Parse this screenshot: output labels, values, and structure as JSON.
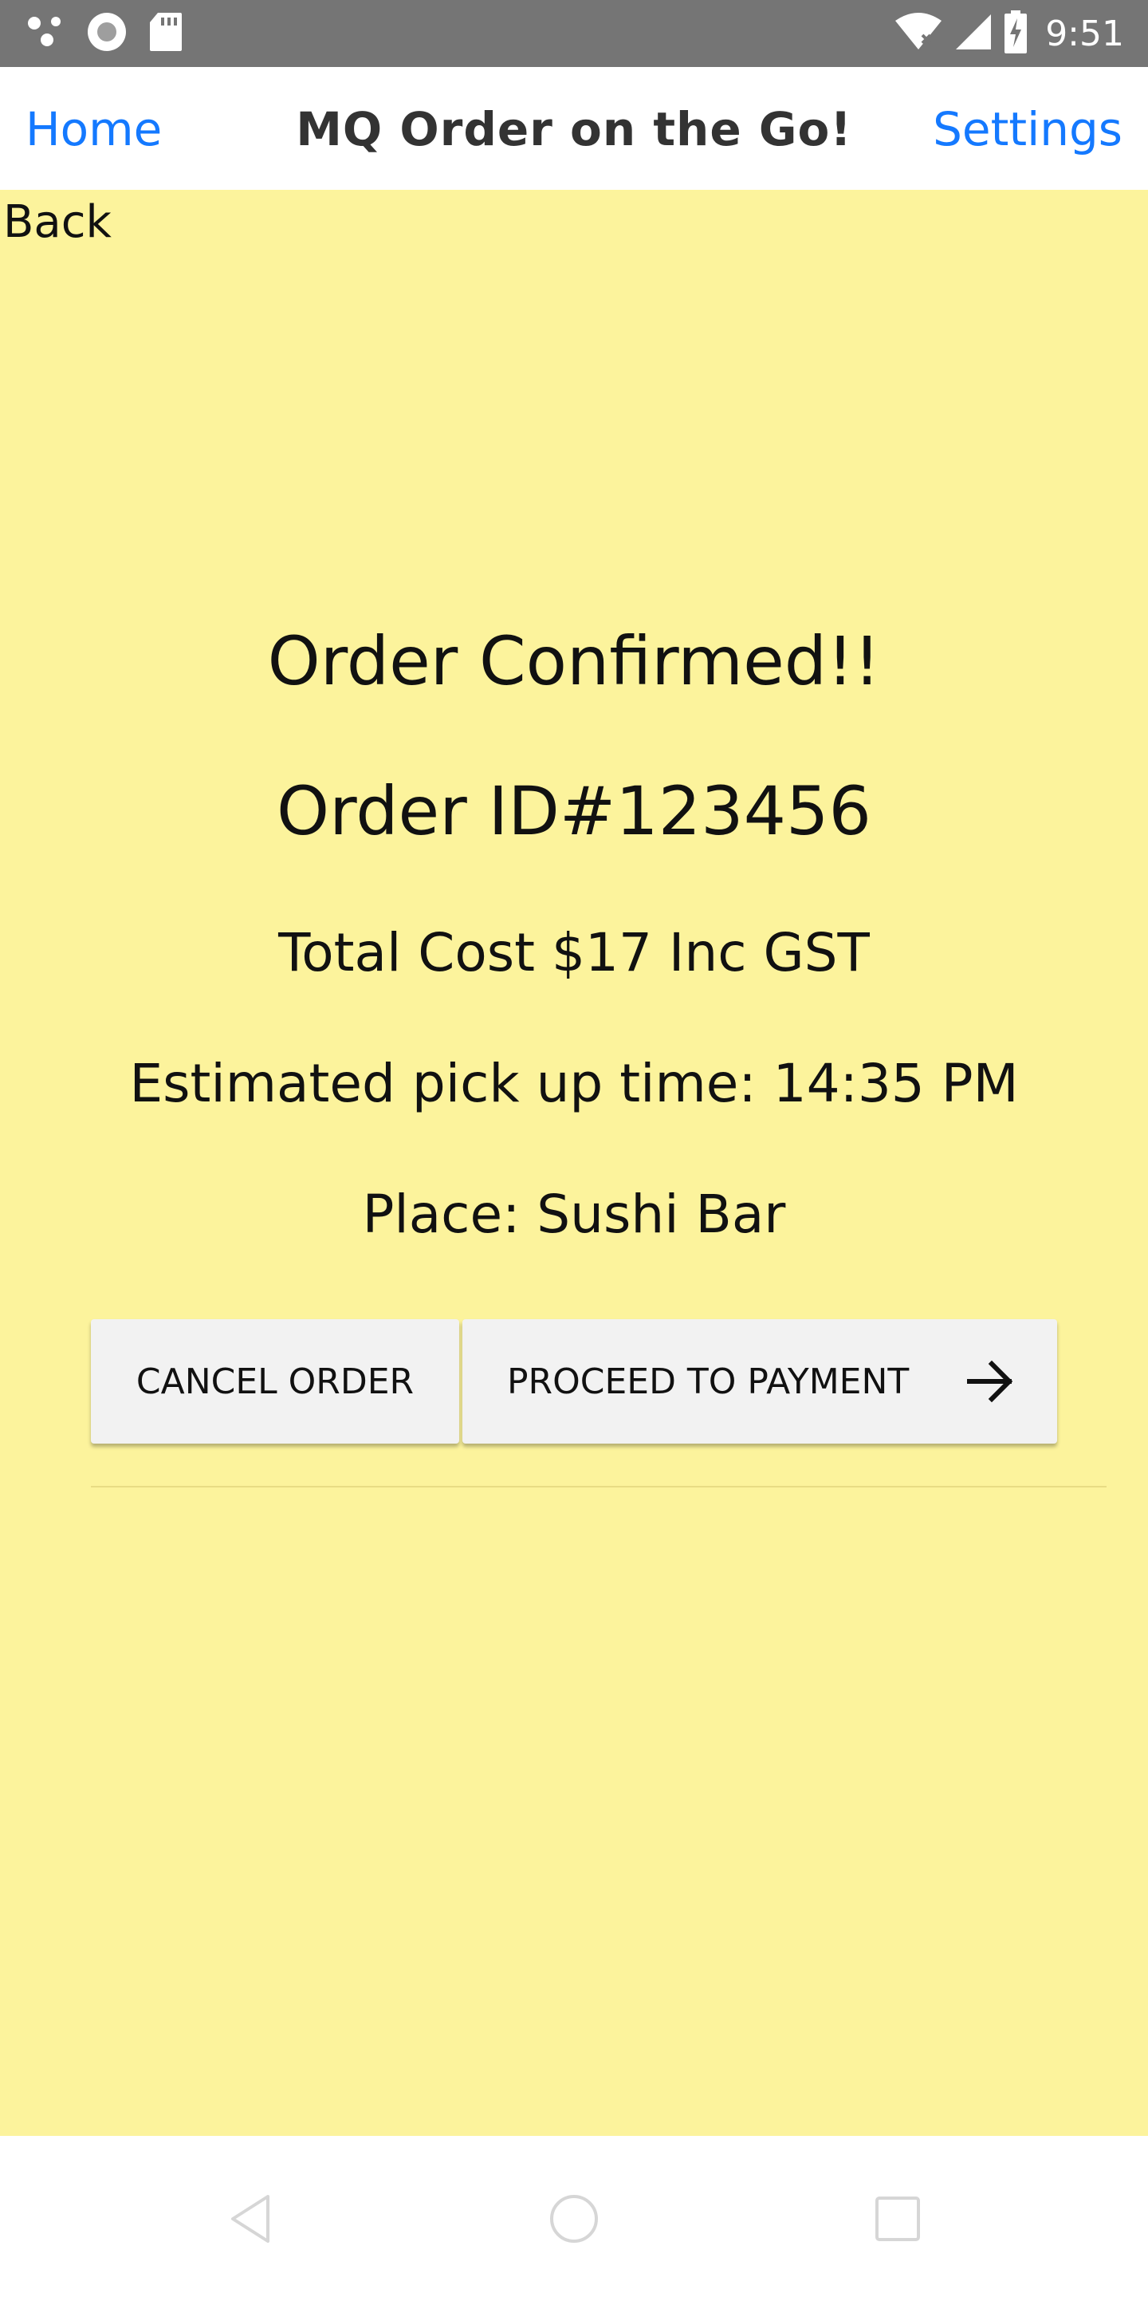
{
  "status_bar": {
    "time": "9:51",
    "icons": [
      "assistant-dots-icon",
      "record-icon",
      "sd-card-icon",
      "wifi-icon",
      "cell-signal-icon",
      "battery-charging-icon"
    ]
  },
  "nav": {
    "home_label": "Home",
    "title": "MQ Order on the Go!",
    "settings_label": "Settings"
  },
  "page": {
    "back_label": "Back",
    "confirmation": "Order Confirmed!!",
    "order_id": "Order ID#123456",
    "total_cost": "Total Cost $17 Inc GST",
    "pickup_time": "Estimated pick up time: 14:35 PM",
    "place": "Place: Sushi Bar"
  },
  "actions": {
    "cancel_label": "CANCEL ORDER",
    "proceed_label": "PROCEED TO PAYMENT",
    "proceed_icon": "arrow-right-icon"
  },
  "system_nav": {
    "icons": [
      "back-triangle-icon",
      "home-circle-icon",
      "recents-square-icon"
    ]
  },
  "colors": {
    "background": "#fcf39c",
    "accent": "#1479ff",
    "status_bar": "#757575",
    "button": "#f2f2f2"
  }
}
